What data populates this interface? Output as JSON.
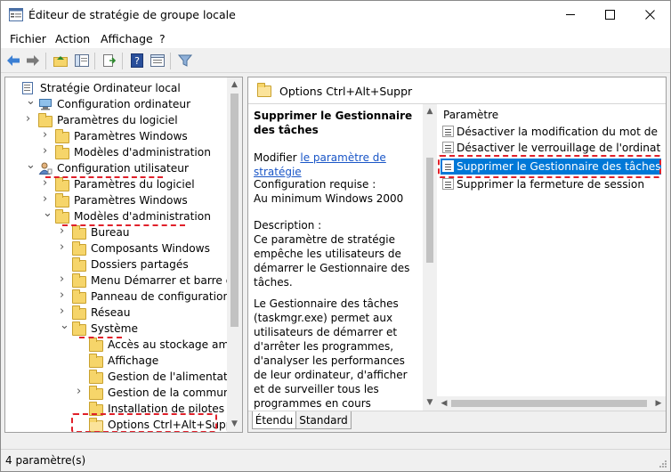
{
  "window": {
    "title": "Éditeur de stratégie de groupe locale"
  },
  "menu": [
    "Fichier",
    "Action",
    "Affichage",
    "?"
  ],
  "tree": [
    {
      "label": "Stratégie Ordinateur local",
      "arrow": "",
      "icon": "computer-policy-icon"
    },
    {
      "label": "Configuration ordinateur",
      "arrow": "v",
      "icon": "computer-config-icon"
    },
    {
      "label": "Paramètres du logiciel",
      "arrow": ">",
      "icon": "folder-icon"
    },
    {
      "label": "Paramètres Windows",
      "arrow": ">",
      "icon": "folder-icon"
    },
    {
      "label": "Modèles d'administration",
      "arrow": ">",
      "icon": "folder-icon"
    },
    {
      "label": "Configuration utilisateur",
      "arrow": "v",
      "icon": "user-config-icon"
    },
    {
      "label": "Paramètres du logiciel",
      "arrow": ">",
      "icon": "folder-icon"
    },
    {
      "label": "Paramètres Windows",
      "arrow": ">",
      "icon": "folder-icon"
    },
    {
      "label": "Modèles d'administration",
      "arrow": "v",
      "icon": "folder-icon"
    },
    {
      "label": "Bureau",
      "arrow": ">",
      "icon": "folder-icon"
    },
    {
      "label": "Composants Windows",
      "arrow": ">",
      "icon": "folder-icon"
    },
    {
      "label": "Dossiers partagés",
      "arrow": "",
      "icon": "folder-icon"
    },
    {
      "label": "Menu Démarrer et barre des tâc",
      "arrow": ">",
      "icon": "folder-icon"
    },
    {
      "label": "Panneau de configuration",
      "arrow": ">",
      "icon": "folder-icon"
    },
    {
      "label": "Réseau",
      "arrow": ">",
      "icon": "folder-icon"
    },
    {
      "label": "Système",
      "arrow": "v",
      "icon": "folder-icon"
    },
    {
      "label": "Accès au stockage amovible",
      "arrow": "",
      "icon": "folder-icon"
    },
    {
      "label": "Affichage",
      "arrow": "",
      "icon": "folder-icon"
    },
    {
      "label": "Gestion de l'alimentation",
      "arrow": "",
      "icon": "folder-icon"
    },
    {
      "label": "Gestion de la communicatio",
      "arrow": ">",
      "icon": "folder-icon"
    },
    {
      "label": "Installation de pilotes",
      "arrow": "",
      "icon": "folder-icon"
    },
    {
      "label": "Options Ctrl+Alt+Suppr",
      "arrow": "",
      "icon": "folder-open-icon"
    }
  ],
  "right_pane": {
    "header": "Options Ctrl+Alt+Suppr",
    "description": {
      "title": "Supprimer le Gestionnaire des tâches",
      "edit_prefix": "Modifier",
      "edit_link": "le paramètre de stratégie",
      "requirements_label": "Configuration requise :",
      "requirements_value": "Au minimum Windows 2000",
      "description_label": "Description :",
      "description_text": "Ce paramètre de stratégie empêche les utilisateurs de démarrer le Gestionnaire des tâches.",
      "description_text2": "Le Gestionnaire des tâches (taskmgr.exe) permet aux utilisateurs de démarrer et d'arrêter les programmes, d'analyser les performances de leur ordinateur, d'afficher et de surveiller tous les programmes en cours d'exécution sur l'ordinateur (dont les services système), de trouver le nom du fichier"
    },
    "list_header": "Paramètre",
    "settings": [
      "Désactiver la modification du mot de passe",
      "Désactiver le verrouillage de l'ordinateur",
      "Supprimer le Gestionnaire des tâches",
      "Supprimer la fermeture de session"
    ],
    "tabs": [
      "Étendu",
      "Standard"
    ]
  },
  "status": "4 paramètre(s)"
}
